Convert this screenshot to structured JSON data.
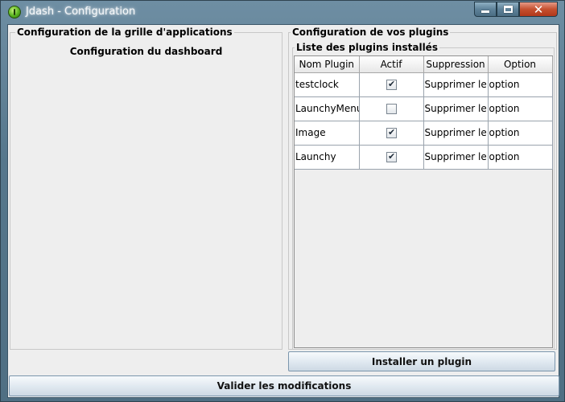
{
  "window": {
    "title": "Jdash - Configuration",
    "controls": {
      "minimize": "minimize",
      "maximize": "maximize",
      "close": "✕"
    }
  },
  "left_panel": {
    "legend": "Configuration de la grille d'applications",
    "subtitle": "Configuration du dashboard"
  },
  "right_panel": {
    "legend": "Configuration de vos plugins",
    "inner_legend": "Liste des plugins installés",
    "table": {
      "headers": [
        "Nom Plugin",
        "Actif",
        "Suppression",
        "Option"
      ],
      "rows": [
        {
          "name": "testclock",
          "active": true,
          "delete": "Supprimer le plugin",
          "option": "option"
        },
        {
          "name": "LaunchyMenu",
          "active": false,
          "delete": "Supprimer le plugin",
          "option": "option"
        },
        {
          "name": "Image",
          "active": true,
          "delete": "Supprimer le plugin",
          "option": "option"
        },
        {
          "name": "Launchy",
          "active": true,
          "delete": "Supprimer le plugin",
          "option": "option"
        }
      ]
    },
    "install_button": "Installer un plugin"
  },
  "validate_button": "Valider les modifications"
}
